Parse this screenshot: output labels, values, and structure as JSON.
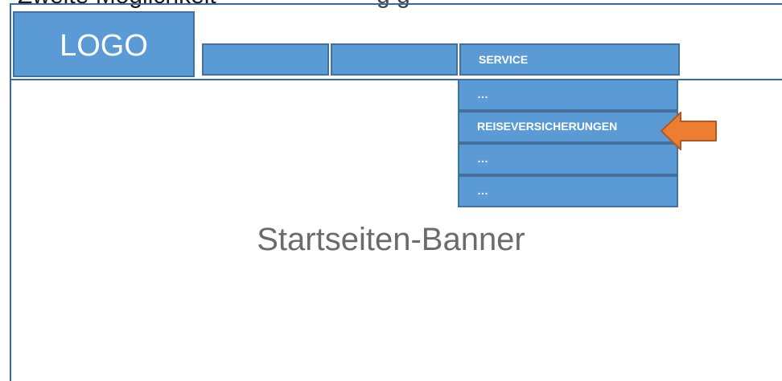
{
  "caption": {
    "lead": "Zweite Möglichkeit",
    "tail": "g                g"
  },
  "header": {
    "logo_label": "LOGO",
    "nav_tabs": [
      {
        "label": ""
      },
      {
        "label": ""
      },
      {
        "label": "SERVICE"
      }
    ]
  },
  "dropdown": {
    "items": [
      {
        "label": "…"
      },
      {
        "label": "REISEVERSICHERUNGEN"
      },
      {
        "label": "…"
      },
      {
        "label": "…"
      }
    ],
    "highlight_arrow_color": "#ed7d31"
  },
  "banner": {
    "label": "Startseiten-Banner"
  },
  "colors": {
    "box_fill": "#5b9bd5",
    "box_border": "#41719c",
    "frame_border": "#3b67a6",
    "arrow": "#ed7d31",
    "banner_text": "#6b6b6b"
  }
}
